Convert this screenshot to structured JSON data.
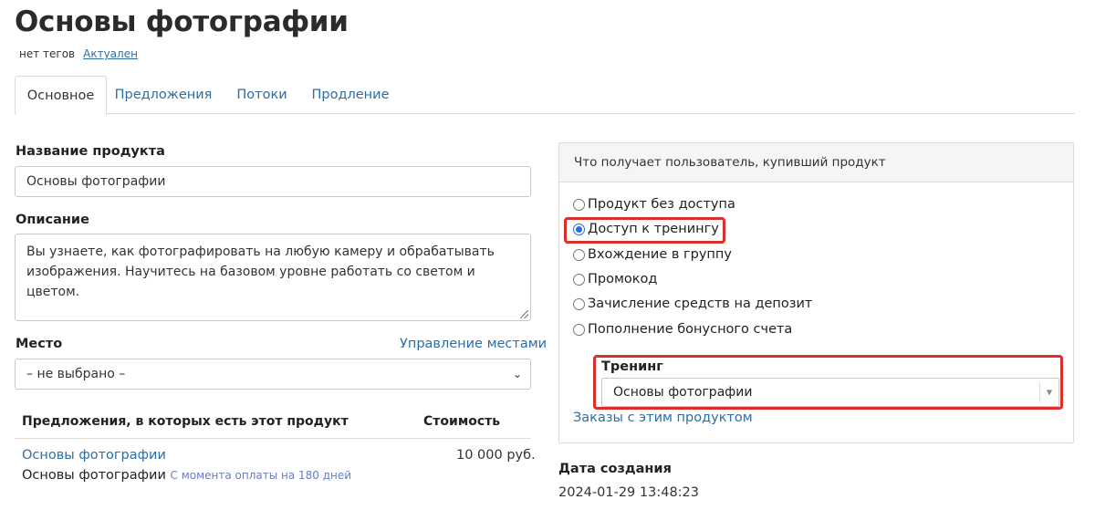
{
  "page": {
    "title": "Основы фотографии",
    "tags": "нет тегов",
    "status": "Актуален"
  },
  "tabs": [
    {
      "label": "Основное",
      "active": true
    },
    {
      "label": "Предложения",
      "active": false
    },
    {
      "label": "Потоки",
      "active": false
    },
    {
      "label": "Продление",
      "active": false
    }
  ],
  "form": {
    "name_label": "Название продукта",
    "name_value": "Основы фотографии",
    "description_label": "Описание",
    "description_value": "Вы узнаете, как фотографировать на любую камеру и обрабатывать\nизображения. Научитесь на базовом уровне работать со светом и цветом.",
    "place_label": "Место",
    "place_manage_link": "Управление местами",
    "place_value": "– не выбрано –"
  },
  "offers_table": {
    "headers": [
      "Предложения, в которых есть этот продукт",
      "Стоимость"
    ],
    "rows": [
      {
        "offer_link": "Основы фотографии",
        "offer_name": "Основы фотографии",
        "offer_note": "С момента оплаты на 180 дней",
        "price": "10 000 руб."
      }
    ]
  },
  "access_panel": {
    "heading": "Что получает пользователь, купивший продукт",
    "options": [
      {
        "label": "Продукт без доступа",
        "checked": false
      },
      {
        "label": "Доступ к тренингу",
        "checked": true
      },
      {
        "label": "Вхождение в группу",
        "checked": false
      },
      {
        "label": "Промокод",
        "checked": false
      },
      {
        "label": "Зачисление средств на депозит",
        "checked": false
      },
      {
        "label": "Пополнение бонусного счета",
        "checked": false
      }
    ],
    "training_label": "Тренинг",
    "training_value": "Основы фотографии",
    "orders_link": "Заказы с этим продуктом"
  },
  "created": {
    "label": "Дата создания",
    "value": "2024-01-29 13:48:23"
  },
  "colors": {
    "link": "#2e6da4",
    "highlight": "#d9302c",
    "radio_checked": "#1a73e8"
  }
}
